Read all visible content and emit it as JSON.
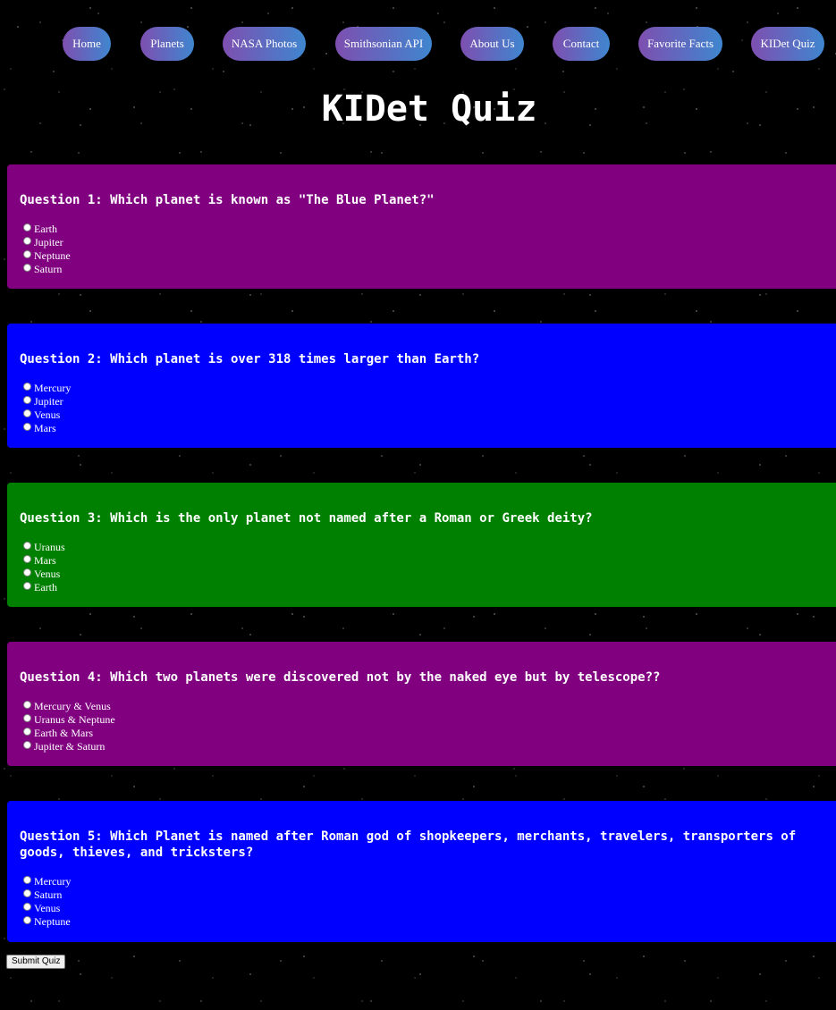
{
  "nav": {
    "items": [
      {
        "label": "Home"
      },
      {
        "label": "Planets"
      },
      {
        "label": "NASA Photos"
      },
      {
        "label": "Smithsonian API"
      },
      {
        "label": "About Us"
      },
      {
        "label": "Contact"
      },
      {
        "label": "Favorite Facts"
      },
      {
        "label": "KIDet Quiz"
      }
    ]
  },
  "page": {
    "title": "KIDet Quiz"
  },
  "colors": {
    "purple": "#800080",
    "blue": "#0000ff",
    "green": "#008000",
    "nav_gradient_start": "#7e4fb0",
    "nav_gradient_end": "#3f86cf"
  },
  "quiz": {
    "questions": [
      {
        "text": "Question 1: Which planet is known as \"The Blue Planet?\"",
        "color": "#800080",
        "options": [
          "Earth",
          "Jupiter",
          "Neptune",
          "Saturn"
        ]
      },
      {
        "text": "Question 2: Which planet is over 318 times larger than Earth?",
        "color": "#0000ff",
        "options": [
          "Mercury",
          "Jupiter",
          "Venus",
          "Mars"
        ]
      },
      {
        "text": "Question 3: Which is the only planet not named after a Roman or Greek deity?",
        "color": "#008000",
        "options": [
          "Uranus",
          "Mars",
          "Venus",
          "Earth"
        ]
      },
      {
        "text": "Question 4: Which two planets were discovered not by the naked eye but by telescope??",
        "color": "#800080",
        "options": [
          "Mercury & Venus",
          "Uranus & Neptune",
          "Earth & Mars",
          "Jupiter & Saturn"
        ]
      },
      {
        "text": "Question 5: Which Planet is named after Roman god of shopkeepers, merchants, travelers, transporters of goods, thieves, and tricksters?",
        "color": "#0000ff",
        "options": [
          "Mercury",
          "Saturn",
          "Venus",
          "Neptune"
        ]
      }
    ],
    "submit_label": "Submit Quiz"
  }
}
